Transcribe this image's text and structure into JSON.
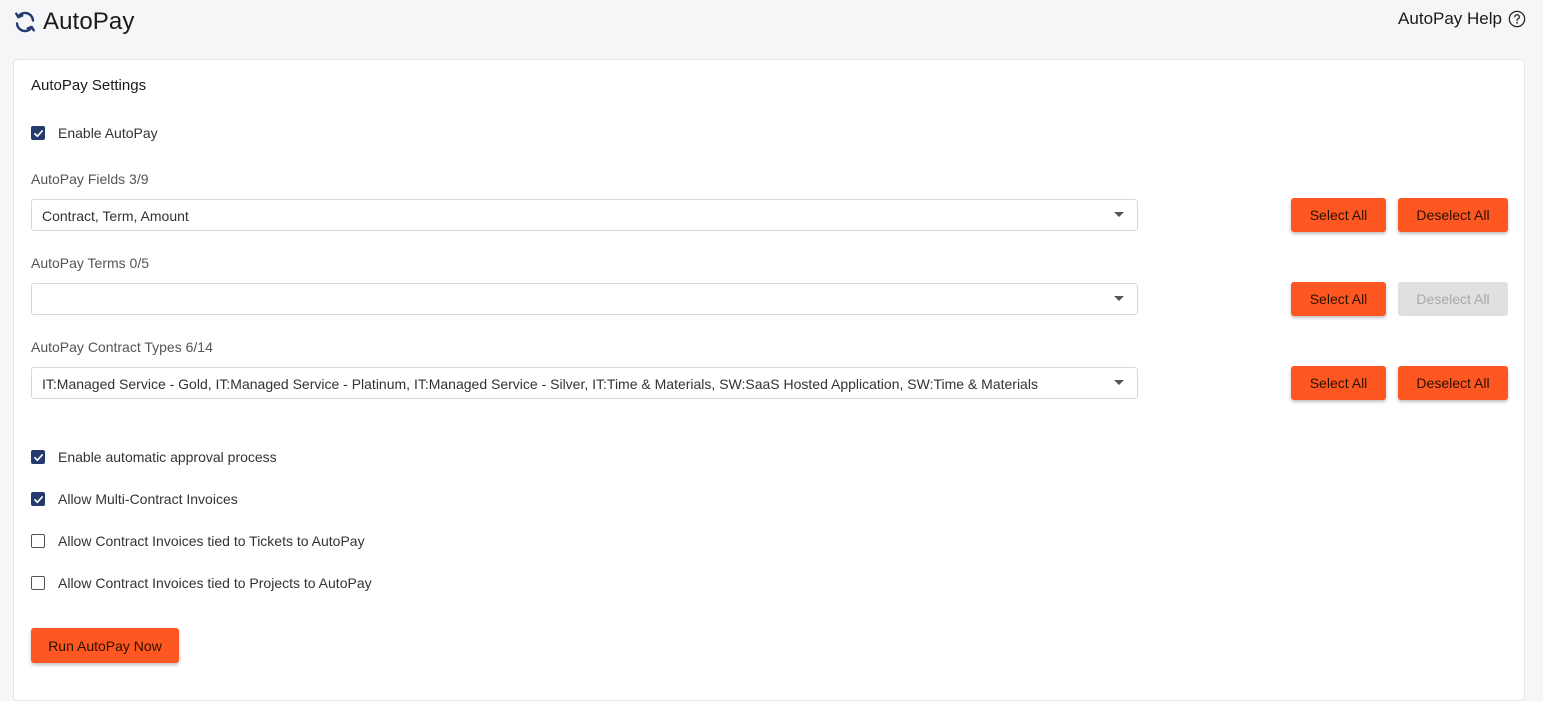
{
  "header": {
    "title": "AutoPay",
    "app_icon": "sync-icon",
    "help_label": "AutoPay Help",
    "help_icon": "question-circle-icon"
  },
  "colors": {
    "accent": "#ff5722",
    "checkbox": "#253b6e",
    "disabled": "#e0e0e0"
  },
  "settings": {
    "title": "AutoPay Settings",
    "enable_autopay": {
      "label": "Enable AutoPay",
      "checked": true
    },
    "fields": {
      "label": "AutoPay Fields 3/9",
      "value": "Contract, Term, Amount",
      "select_all": "Select All",
      "deselect_all": "Deselect All",
      "deselect_disabled": false
    },
    "terms": {
      "label": "AutoPay Terms 0/5",
      "value": "",
      "select_all": "Select All",
      "deselect_all": "Deselect All",
      "deselect_disabled": true
    },
    "contract_types": {
      "label": "AutoPay Contract Types 6/14",
      "value": "IT:Managed Service - Gold, IT:Managed Service - Platinum, IT:Managed Service - Silver, IT:Time & Materials, SW:SaaS Hosted Application, SW:Time & Materials",
      "select_all": "Select All",
      "deselect_all": "Deselect All",
      "deselect_disabled": false
    },
    "options": [
      {
        "label": "Enable automatic approval process",
        "checked": true
      },
      {
        "label": "Allow Multi-Contract Invoices",
        "checked": true
      },
      {
        "label": "Allow Contract Invoices tied to Tickets to AutoPay",
        "checked": false
      },
      {
        "label": "Allow Contract Invoices tied to Projects to AutoPay",
        "checked": false
      }
    ],
    "run_button": "Run AutoPay Now"
  }
}
